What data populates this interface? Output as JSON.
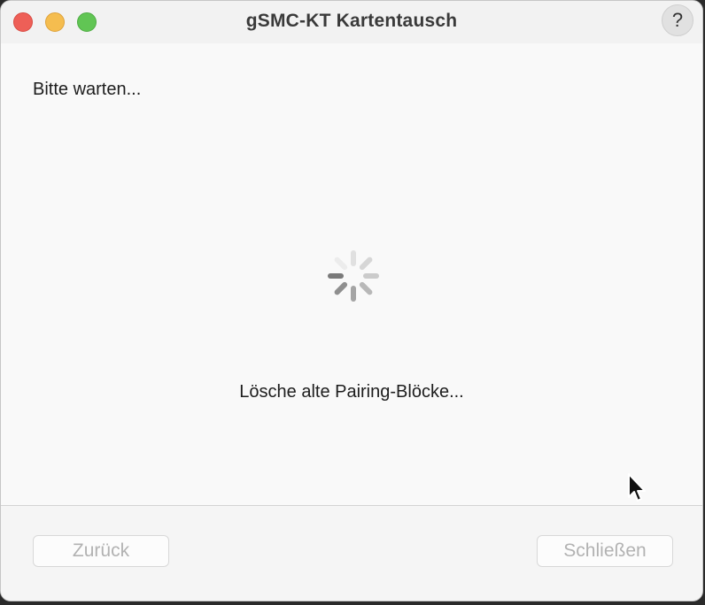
{
  "window": {
    "title": "gSMC-KT Kartentausch",
    "help_label": "?"
  },
  "content": {
    "heading": "Bitte warten...",
    "status": "Lösche alte Pairing-Blöcke..."
  },
  "footer": {
    "back_label": "Zurück",
    "close_label": "Schließen",
    "buttons_enabled": false
  },
  "icons": {
    "close": "close-traffic-light",
    "minimize": "minimize-traffic-light",
    "maximize": "maximize-traffic-light",
    "spinner": "loading-spinner-icon",
    "cursor": "mouse-pointer-icon"
  },
  "colors": {
    "close": "#ee5f57",
    "minimize": "#f5bd4f",
    "maximize": "#61c554"
  }
}
